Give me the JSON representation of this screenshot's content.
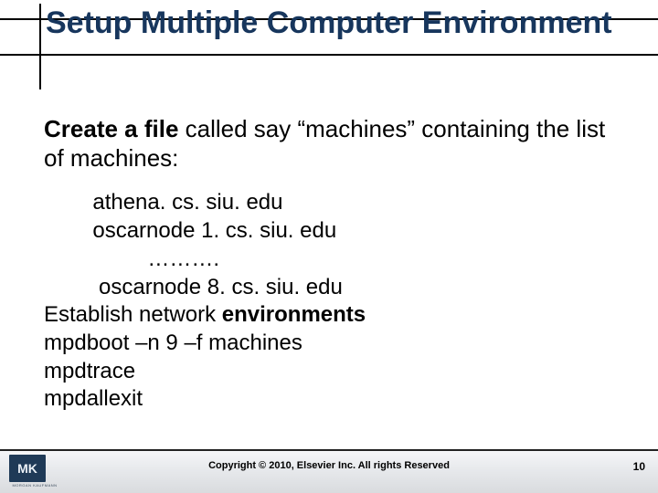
{
  "title": "Setup Multiple Computer Environment",
  "lead": {
    "bold": "Create a file",
    "rest": " called say “machines” containing the list of machines:"
  },
  "lines": {
    "l1": "        athena. cs. siu. edu",
    "l2": "        oscarnode 1. cs. siu. edu",
    "l3": "                 ……….",
    "l4": "         oscarnode 8. cs. siu. edu",
    "l5_a": "Establish network ",
    "l5_b": "environments",
    "l6": "mpdboot –n 9 –f machines",
    "l7": "mpdtrace",
    "l8": "mpdallexit"
  },
  "footer": {
    "copyright": "Copyright © 2010, Elsevier Inc. All rights Reserved",
    "page": "10"
  },
  "logo": {
    "initials": "MK",
    "sub": "MORGAN KAUFMANN"
  }
}
